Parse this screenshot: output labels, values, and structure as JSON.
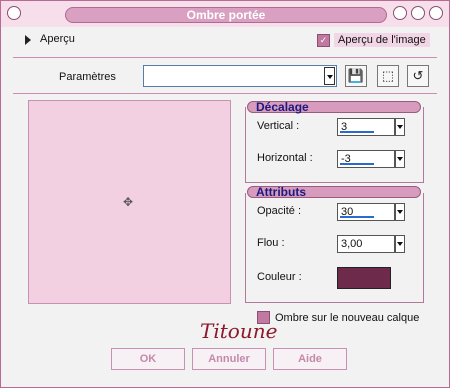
{
  "window": {
    "title": "Ombre portée"
  },
  "preview_row": {
    "toggle_label": "Aperçu",
    "checkbox_label": "Aperçu de l'image",
    "checkbox_checked": true
  },
  "params": {
    "label": "Paramètres",
    "preset_value": ""
  },
  "decalage": {
    "title": "Décalage",
    "vertical_label": "Vertical :",
    "vertical_value": "3",
    "horizontal_label": "Horizontal :",
    "horizontal_value": "-3"
  },
  "attributs": {
    "title": "Attributs",
    "opacite_label": "Opacité :",
    "opacite_value": "30",
    "flou_label": "Flou :",
    "flou_value": "3,00",
    "couleur_label": "Couleur :",
    "couleur_hex": "#6d2a4a"
  },
  "shadow_layer": {
    "label": "Ombre sur le nouveau calque",
    "checked": true
  },
  "signature": "Titoune",
  "buttons": {
    "ok": "OK",
    "cancel": "Annuler",
    "help": "Aide"
  },
  "icons": {
    "save": "save-icon",
    "load": "cube-icon",
    "reset": "reset-icon",
    "crosshair": "crosshair-icon"
  },
  "colors": {
    "accent": "#d79bbd",
    "preview_bg": "#f3cfe2"
  }
}
